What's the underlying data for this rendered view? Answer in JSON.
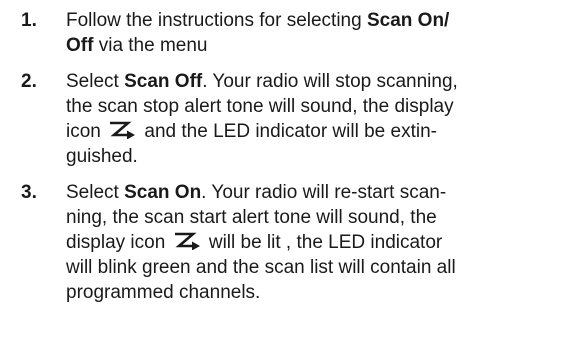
{
  "steps": [
    {
      "number": "1.",
      "lines": [
        {
          "a": "Follow the instructions for selecting ",
          "b": "Scan On/"
        },
        {
          "b": "Off",
          "c": " via the menu"
        }
      ]
    },
    {
      "number": "2.",
      "lines": [
        {
          "a": "Select ",
          "b": "Scan Off",
          "c": ". Your radio will stop scanning,"
        },
        {
          "a": "the scan stop alert tone  will sound, the display"
        },
        {
          "a": "icon",
          "icon": "scan-icon",
          "c": " and the LED indicator will be extin-"
        },
        {
          "a": "guished."
        }
      ]
    },
    {
      "number": "3.",
      "lines": [
        {
          "a": "Select ",
          "b": "Scan On",
          "c": ". Your radio will re-start scan-"
        },
        {
          "a": "ning, the scan start alert tone  will sound, the"
        },
        {
          "a": "display icon",
          "icon": "scan-icon",
          "c": " will be lit , the LED indicator"
        },
        {
          "a": "will blink green and the scan list will contain all"
        },
        {
          "a": "programmed channels."
        }
      ]
    }
  ]
}
